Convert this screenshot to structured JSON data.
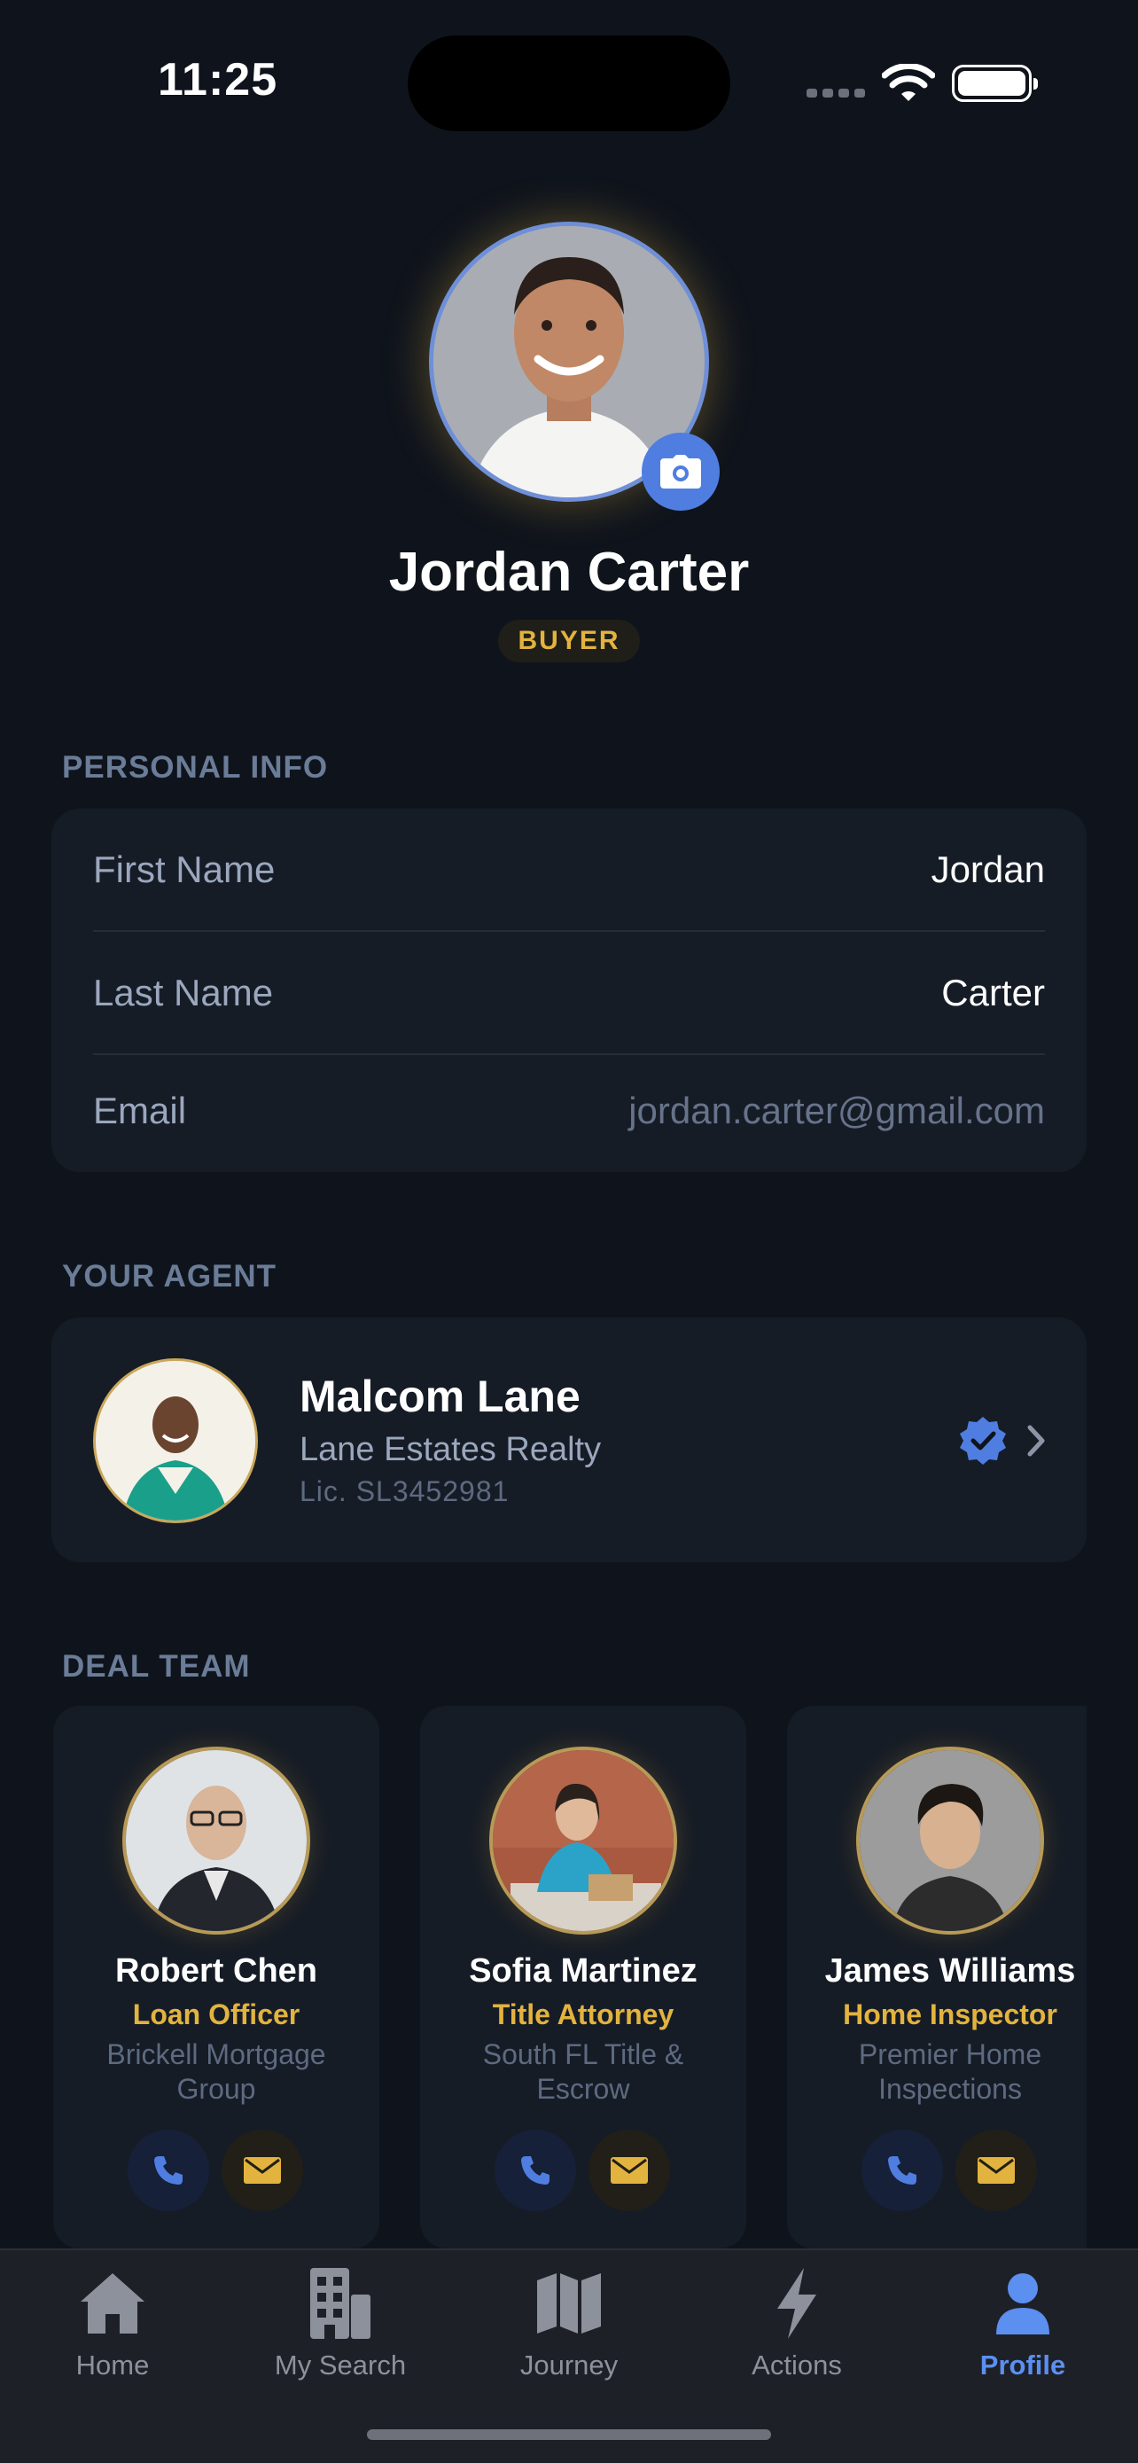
{
  "status_bar": {
    "time": "11:25"
  },
  "profile": {
    "name": "Jordan Carter",
    "role": "BUYER"
  },
  "personal_info": {
    "section_label": "PERSONAL INFO",
    "rows": [
      {
        "label": "First Name",
        "value": "Jordan"
      },
      {
        "label": "Last Name",
        "value": "Carter"
      },
      {
        "label": "Email",
        "value": "jordan.carter@gmail.com"
      }
    ]
  },
  "agent": {
    "section_label": "YOUR AGENT",
    "name": "Malcom Lane",
    "company": "Lane Estates Realty",
    "license": "Lic. SL3452981"
  },
  "deal_team": {
    "section_label": "DEAL TEAM",
    "members": [
      {
        "name": "Robert Chen",
        "role": "Loan Officer",
        "company": "Brickell Mortgage Group"
      },
      {
        "name": "Sofia Martinez",
        "role": "Title Attorney",
        "company": "South FL Title & Escrow"
      },
      {
        "name": "James Williams",
        "role": "Home Inspector",
        "company": "Premier Home Inspections"
      }
    ]
  },
  "tabs": [
    {
      "label": "Home",
      "icon": "house-icon"
    },
    {
      "label": "My Search",
      "icon": "building-icon"
    },
    {
      "label": "Journey",
      "icon": "map-icon"
    },
    {
      "label": "Actions",
      "icon": "bolt-icon"
    },
    {
      "label": "Profile",
      "icon": "person-icon",
      "active": true
    }
  ],
  "colors": {
    "background": "#0f141c",
    "card": "#161c26",
    "accent_blue": "#5b8ff0",
    "accent_gold": "#e2b33f"
  }
}
